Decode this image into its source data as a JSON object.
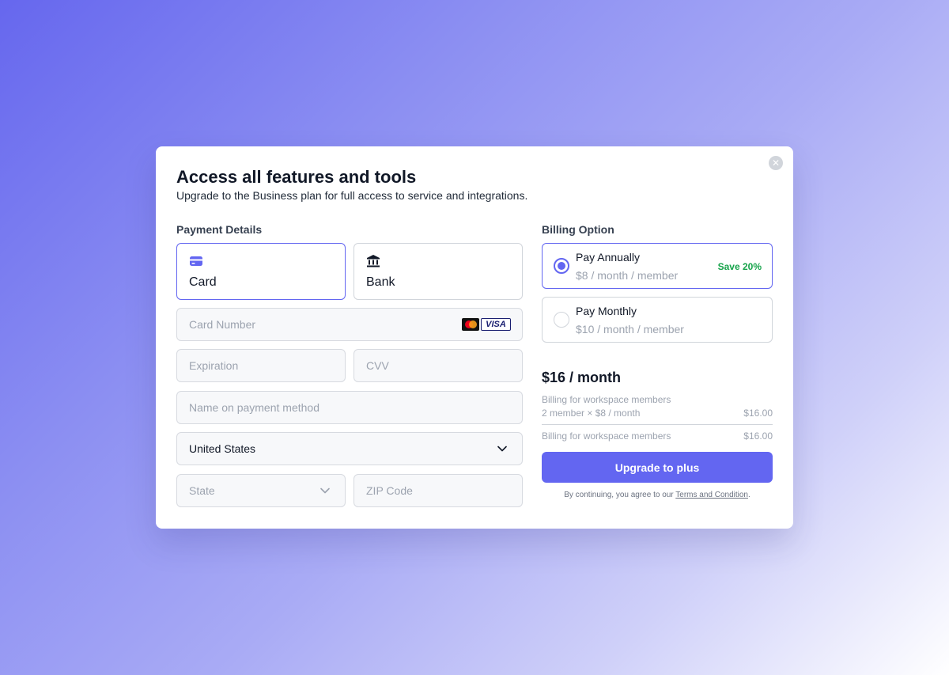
{
  "modal": {
    "title": "Access all features and tools",
    "subtitle": "Upgrade to the Business plan for full access to service and integrations."
  },
  "payment": {
    "section_label": "Payment Details",
    "methods": [
      {
        "label": "Card",
        "icon": "credit-card-icon",
        "selected": true
      },
      {
        "label": "Bank",
        "icon": "bank-icon",
        "selected": false
      }
    ],
    "card_number_placeholder": "Card Number",
    "card_brands": [
      "mastercard",
      "VISA"
    ],
    "expiration_placeholder": "Expiration",
    "cvv_placeholder": "CVV",
    "name_placeholder": "Name on payment method",
    "country_value": "United States",
    "state_placeholder": "State",
    "zip_placeholder": "ZIP Code"
  },
  "billing": {
    "section_label": "Billing Option",
    "plans": [
      {
        "name": "Pay Annually",
        "price": "$8 / month / member",
        "badge": "Save 20%",
        "selected": true
      },
      {
        "name": "Pay Monthly",
        "price": "$10 / month / member",
        "badge": "",
        "selected": false
      }
    ],
    "total": "$16 / month",
    "line1_label": "Billing for workspace members",
    "line1_detail": "2 member × $8 / month",
    "line1_amount": "$16.00",
    "line2_label": "Billing for workspace members",
    "line2_amount": "$16.00",
    "cta": "Upgrade to plus",
    "terms_prefix": "By continuing, you agree to our",
    "terms_link": "Terms and Condition",
    "terms_suffix": "."
  },
  "colors": {
    "accent": "#6366f1",
    "save_green": "#16a34a"
  }
}
